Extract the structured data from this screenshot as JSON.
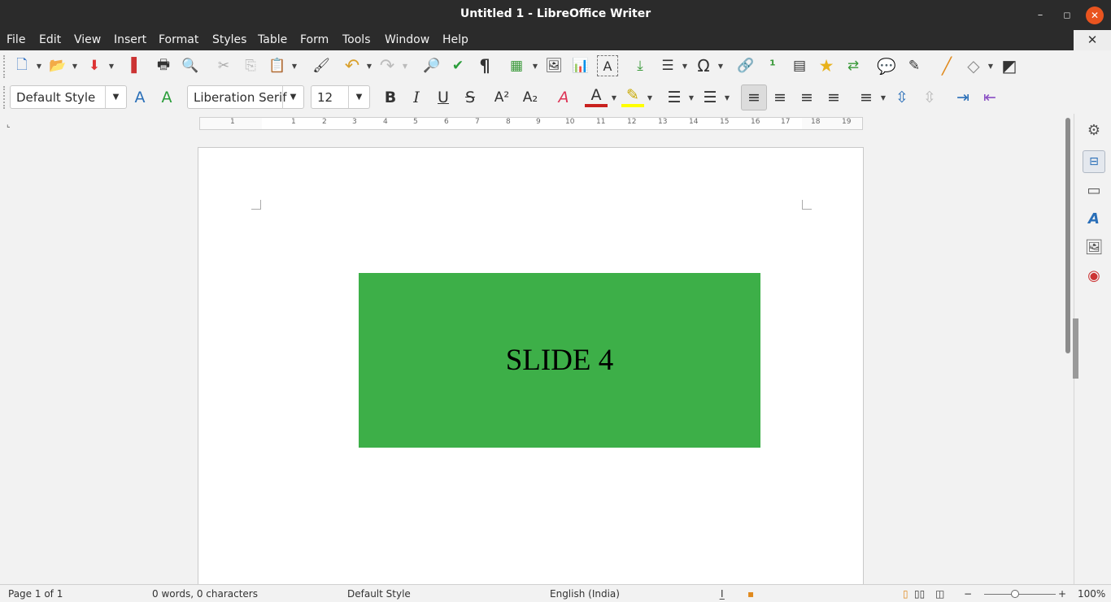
{
  "window": {
    "title": "Untitled 1 - LibreOffice Writer",
    "minimize": "–",
    "maximize": "◻",
    "close": "✕",
    "doc_close": "✕"
  },
  "menu": [
    "File",
    "Edit",
    "View",
    "Insert",
    "Format",
    "Styles",
    "Table",
    "Form",
    "Tools",
    "Window",
    "Help"
  ],
  "standard_toolbar": [
    {
      "name": "new-document-icon",
      "glyph": "🗋"
    },
    {
      "name": "open-folder-icon",
      "glyph": "📂"
    },
    {
      "name": "save-icon",
      "glyph": "⬇"
    },
    {
      "name": "export-pdf-icon",
      "glyph": "▌"
    },
    {
      "name": "print-icon",
      "glyph": "🖶"
    },
    {
      "name": "print-preview-icon",
      "glyph": "🔍"
    },
    {
      "name": "cut-icon",
      "glyph": "✂"
    },
    {
      "name": "copy-icon",
      "glyph": "⎘"
    },
    {
      "name": "paste-icon",
      "glyph": "📋"
    },
    {
      "name": "clone-formatting-icon",
      "glyph": "🖌"
    },
    {
      "name": "undo-icon",
      "glyph": "↶"
    },
    {
      "name": "redo-icon",
      "glyph": "↷"
    },
    {
      "name": "find-replace-icon",
      "glyph": "🔎"
    },
    {
      "name": "spelling-icon",
      "glyph": "✔"
    },
    {
      "name": "formatting-marks-icon",
      "glyph": "¶"
    },
    {
      "name": "insert-table-icon",
      "glyph": "▦"
    },
    {
      "name": "insert-image-icon",
      "glyph": "🖼"
    },
    {
      "name": "insert-chart-icon",
      "glyph": "📊"
    },
    {
      "name": "insert-textbox-icon",
      "glyph": "A"
    },
    {
      "name": "page-break-icon",
      "glyph": "⤓"
    },
    {
      "name": "insert-field-icon",
      "glyph": "☰"
    },
    {
      "name": "special-character-icon",
      "glyph": "Ω"
    },
    {
      "name": "hyperlink-icon",
      "glyph": "🔗"
    },
    {
      "name": "footnote-icon",
      "glyph": "¹"
    },
    {
      "name": "endnote-icon",
      "glyph": "▤"
    },
    {
      "name": "bookmark-icon",
      "glyph": "★"
    },
    {
      "name": "cross-reference-icon",
      "glyph": "⇄"
    },
    {
      "name": "comment-icon",
      "glyph": "💬"
    },
    {
      "name": "track-changes-icon",
      "glyph": "✎"
    },
    {
      "name": "line-icon",
      "glyph": "╱"
    },
    {
      "name": "basic-shapes-icon",
      "glyph": "◇"
    },
    {
      "name": "draw-functions-icon",
      "glyph": "◩"
    }
  ],
  "formatting_toolbar": {
    "paragraph_style": "Default Style",
    "font_name": "Liberation Serif",
    "font_size": "12",
    "update_style_icon": "A",
    "new_style_icon": "A",
    "bold": "B",
    "italic": "I",
    "underline": "U",
    "strikethrough": "S",
    "superscript": "A²",
    "subscript": "A₂",
    "clear_formatting": "A",
    "font_color": "A",
    "highlight": "✎",
    "bullets": "☰",
    "numbering": "☰",
    "align_left": "≡",
    "align_center": "≡",
    "align_right": "≡",
    "justify": "≡",
    "line_spacing": "≡",
    "para_spacing": "⇳",
    "decrease_para_spacing": "⇳",
    "increase_indent": "⇥",
    "decrease_indent": "⇤"
  },
  "ruler": {
    "numbers": [
      "1",
      "1",
      "2",
      "3",
      "4",
      "5",
      "6",
      "7",
      "8",
      "9",
      "10",
      "11",
      "12",
      "13",
      "14",
      "15",
      "16",
      "17",
      "18",
      "19"
    ],
    "corner": "⌞"
  },
  "document": {
    "slide_text": "SLIDE 4",
    "slide_color": "#3daf48"
  },
  "sidebar": [
    {
      "name": "properties-icon",
      "glyph": "⚙"
    },
    {
      "name": "page-icon",
      "glyph": "▭"
    },
    {
      "name": "styles-icon",
      "glyph": "A"
    },
    {
      "name": "gallery-icon",
      "glyph": "🖼"
    },
    {
      "name": "navigator-icon",
      "glyph": "◉"
    }
  ],
  "statusbar": {
    "page": "Page 1 of 1",
    "words": "0 words, 0 characters",
    "style": "Default Style",
    "language": "English (India)",
    "selection_icon": "I̲",
    "doc_modified_icon": "▪",
    "zoom_minus": "−",
    "zoom_plus": "+",
    "zoom": "100%"
  },
  "colors": {
    "titlebar": "#2b2b2b",
    "close_button": "#e9541f",
    "font_color_underline": "#c9211e",
    "highlight_underline": "#ffff00"
  }
}
